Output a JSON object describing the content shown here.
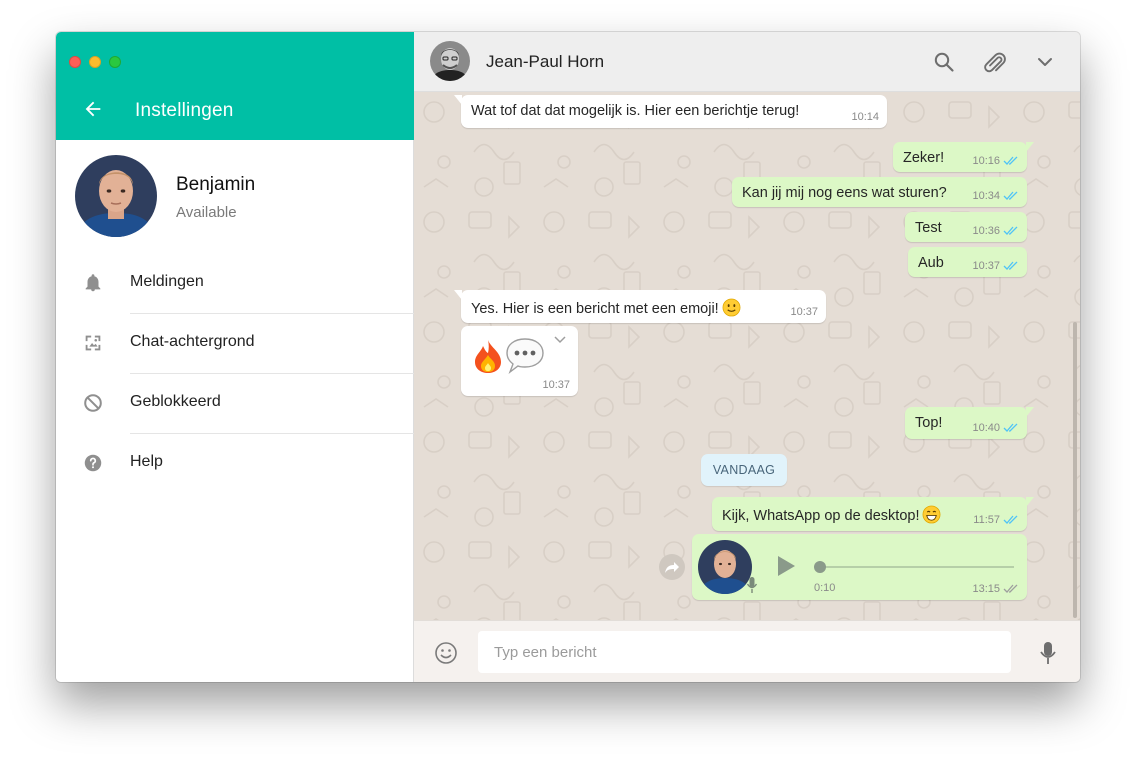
{
  "settings": {
    "title": "Instellingen",
    "profile": {
      "name": "Benjamin",
      "status": "Available"
    },
    "menu": [
      {
        "label": "Meldingen",
        "icon": "bell-icon"
      },
      {
        "label": "Chat-achtergrond",
        "icon": "wallpaper-icon"
      },
      {
        "label": "Geblokkeerd",
        "icon": "blocked-icon"
      },
      {
        "label": "Help",
        "icon": "help-icon"
      }
    ]
  },
  "chat": {
    "contact_name": "Jean-Paul Horn",
    "messages": [
      {
        "dir": "in",
        "text": "Wat tof dat dat mogelijk is. Hier een berichtje terug!",
        "time": "10:14"
      },
      {
        "dir": "out",
        "text": "Zeker!",
        "time": "10:16",
        "status": "read"
      },
      {
        "dir": "out",
        "text": "Kan jij mij nog eens wat sturen?",
        "time": "10:34",
        "status": "read"
      },
      {
        "dir": "out",
        "text": "Test",
        "time": "10:36",
        "status": "read"
      },
      {
        "dir": "out",
        "text": "Aub",
        "time": "10:37",
        "status": "read"
      },
      {
        "dir": "in",
        "text": "Yes. Hier is een bericht met een emoji!",
        "time": "10:37",
        "emoji": "slightly-smiling-face"
      },
      {
        "dir": "in",
        "type": "emoji-only",
        "emojis": [
          "fire",
          "speech-balloon"
        ],
        "time": "10:37"
      },
      {
        "dir": "out",
        "text": "Top!",
        "time": "10:40",
        "status": "read"
      },
      {
        "dir": "out",
        "text": "Kijk, WhatsApp op de desktop!",
        "time": "11:57",
        "status": "read",
        "emoji": "grinning-face"
      },
      {
        "dir": "out",
        "type": "voice",
        "duration": "0:10",
        "time": "13:15",
        "status": "delivered"
      }
    ],
    "day_separator": "VANDAAG"
  },
  "composer": {
    "placeholder": "Typ een bericht"
  },
  "colors": {
    "brand": "#00bfa5",
    "outgoing": "#dcf8c6",
    "incoming": "#ffffff",
    "read_tick": "#4fc3f7"
  }
}
